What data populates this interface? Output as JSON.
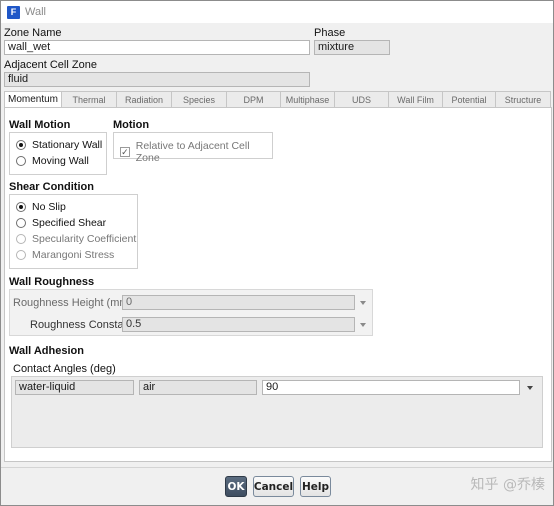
{
  "window": {
    "title": "Wall",
    "app_icon_glyph": "F"
  },
  "zone_name": {
    "label": "Zone Name",
    "value": "wall_wet"
  },
  "phase": {
    "label": "Phase",
    "value": "mixture"
  },
  "adjacent_cell_zone": {
    "label": "Adjacent Cell Zone",
    "value": "fluid"
  },
  "tabs": [
    {
      "label": "Momentum",
      "active": true
    },
    {
      "label": "Thermal"
    },
    {
      "label": "Radiation"
    },
    {
      "label": "Species"
    },
    {
      "label": "DPM"
    },
    {
      "label": "Multiphase"
    },
    {
      "label": "UDS"
    },
    {
      "label": "Wall Film"
    },
    {
      "label": "Potential"
    },
    {
      "label": "Structure"
    }
  ],
  "wall_motion": {
    "title": "Wall Motion",
    "options": [
      {
        "label": "Stationary Wall",
        "selected": true
      },
      {
        "label": "Moving Wall",
        "selected": false
      }
    ]
  },
  "motion": {
    "title": "Motion",
    "relative_checkbox": {
      "label": "Relative to Adjacent Cell Zone",
      "checked": true,
      "check_glyph": "✓"
    }
  },
  "shear_condition": {
    "title": "Shear Condition",
    "options": [
      {
        "label": "No Slip",
        "selected": true,
        "enabled": true
      },
      {
        "label": "Specified Shear",
        "selected": false,
        "enabled": true
      },
      {
        "label": "Specularity Coefficient",
        "selected": false,
        "enabled": false
      },
      {
        "label": "Marangoni Stress",
        "selected": false,
        "enabled": false
      }
    ]
  },
  "wall_roughness": {
    "title": "Wall Roughness",
    "height": {
      "label": "Roughness Height (mm)",
      "value": "0"
    },
    "constant": {
      "label": "Roughness Constant",
      "value": "0.5"
    }
  },
  "wall_adhesion": {
    "title": "Wall Adhesion",
    "contact_angles_label": "Contact Angles (deg)",
    "row": {
      "phase1": "water-liquid",
      "phase2": "air",
      "angle": "90"
    }
  },
  "buttons": {
    "ok": "OK",
    "cancel": "Cancel",
    "help": "Help"
  },
  "watermark": "知乎 @乔楱",
  "colors": {
    "primary_button": "#3e4d60",
    "app_icon": "#1f57c8"
  }
}
